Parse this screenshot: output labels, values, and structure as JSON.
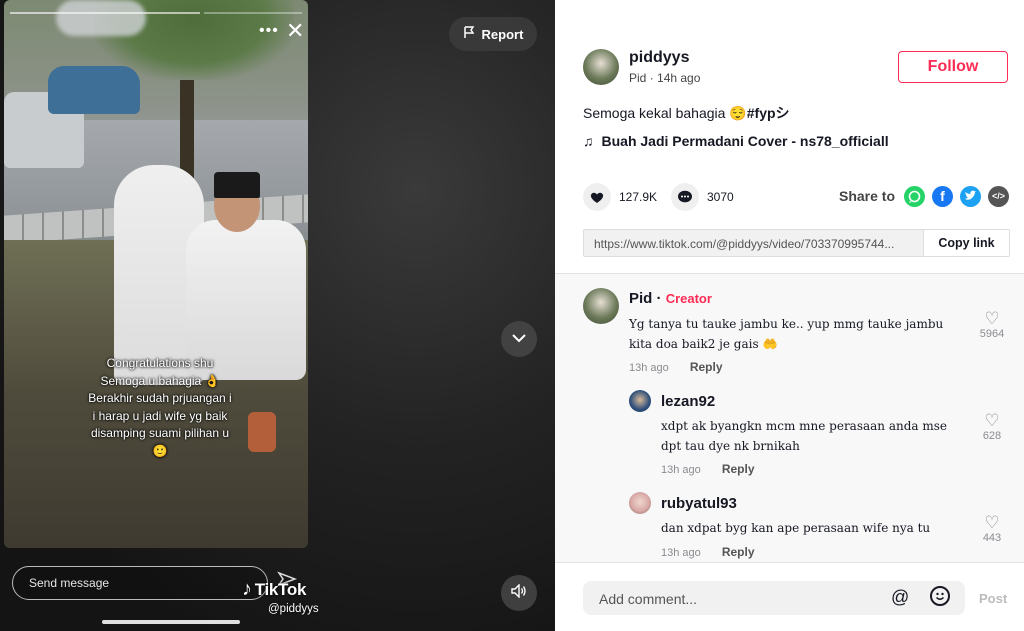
{
  "video": {
    "caption_lines": [
      "Congratulations shu",
      "Semoga u bahagia 👌",
      "Berakhir sudah prjuangan i",
      "i harap u jadi wife yg baik",
      "disamping suami pilihan u",
      "🙂"
    ],
    "send_message_placeholder": "Send message",
    "watermark_brand": "TikTok",
    "watermark_handle": "@piddyys",
    "report_label": "Report",
    "more_icon": "•••",
    "close_icon": "✕"
  },
  "post": {
    "username": "piddyys",
    "display_name": "Pid",
    "time_ago": "14h ago",
    "follow_label": "Follow",
    "description": "Semoga kekal bahagia 😌",
    "hashtag": "#fypシ",
    "music": "Buah Jadi Permadani Cover - ns78_officiall",
    "likes": "127.9K",
    "comments_count": "3070",
    "share_label": "Share to",
    "link": "https://www.tiktok.com/@piddyys/video/703370995744...",
    "copy_link_label": "Copy link"
  },
  "comments": [
    {
      "name": "Pid",
      "creator_label": "Creator",
      "text": "Yg tanya tu tauke jambu ke.. yup mmg tauke jambu kita doa baik2 je gais 🤲",
      "time": "13h ago",
      "reply_label": "Reply",
      "likes": "5964"
    },
    {
      "name": "lezan92",
      "text": "xdpt ak byangkn mcm mne perasaan anda mse dpt tau dye nk brnikah",
      "time": "13h ago",
      "reply_label": "Reply",
      "likes": "628"
    },
    {
      "name": "rubyatul93",
      "text": "dan xdpat byg kan ape perasaan wife nya tu",
      "time": "13h ago",
      "reply_label": "Reply",
      "likes": "443"
    }
  ],
  "composer": {
    "placeholder": "Add comment...",
    "post_label": "Post"
  },
  "colors": {
    "accent": "#fe2c55",
    "whatsapp": "#25d366",
    "facebook": "#1877f2",
    "twitter": "#1da1f2",
    "embed": "#555555"
  }
}
